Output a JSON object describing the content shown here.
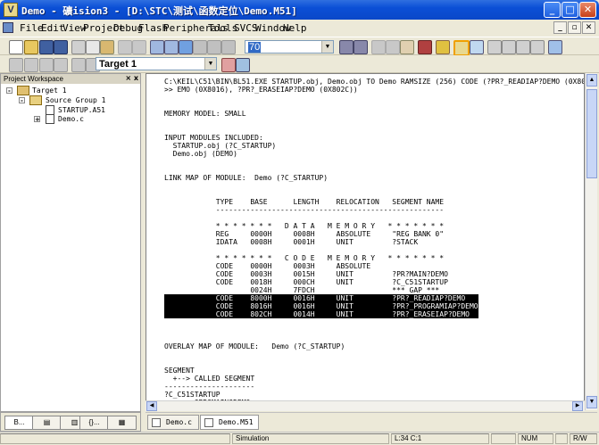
{
  "window": {
    "title": "Demo  - 礦ision3 - [D:\\STC\\测试\\函数定位\\Demo.M51]",
    "app_icon": "V"
  },
  "menu": [
    "File",
    "Edit",
    "View",
    "Project",
    "Debug",
    "Flash",
    "Peripherals",
    "Tools",
    "SVCS",
    "Window",
    "Help"
  ],
  "toolbar": {
    "find_value": "70",
    "target_value": "Target 1",
    "icons": [
      "new-file-icon",
      "open-folder-icon",
      "save-icon",
      "save-all-icon",
      "cut-icon",
      "copy-icon",
      "paste-icon",
      "undo-icon",
      "redo-icon",
      "indent-icon",
      "unindent-icon",
      "bookmark-icon",
      "bookmark-prev-icon",
      "bookmark-next-icon",
      "bookmark-clear-icon",
      "find-icon",
      "find-in-files-icon",
      "back-icon",
      "forward-icon",
      "browse-icon",
      "print-icon",
      "debug-icon"
    ]
  },
  "workspace": {
    "title": "Project Workspace",
    "tree": {
      "target": "Target 1",
      "group": "Source Group 1",
      "files": [
        "STARTUP.A51",
        "Demo.c"
      ]
    },
    "tabs": [
      "B...",
      "",
      "",
      "{}...",
      ""
    ]
  },
  "editor": {
    "lines": [
      "C:\\KEIL\\C51\\BIN\\BL51.EXE STARTUP.obj, Demo.obj TO Demo RAMSIZE (256) CODE (?PR?_READIAP?DEMO (0X80",
      ">> EMO (0X8016), ?PR?_ERASEIAP?DEMO (0X802C))",
      "",
      "",
      "MEMORY MODEL: SMALL",
      "",
      "",
      "INPUT MODULES INCLUDED:",
      "  STARTUP.obj (?C_STARTUP)",
      "  Demo.obj (DEMO)",
      "",
      "",
      "LINK MAP OF MODULE:  Demo (?C_STARTUP)",
      "",
      "",
      "            TYPE    BASE      LENGTH    RELOCATION   SEGMENT NAME",
      "            -----------------------------------------------------",
      "",
      "            * * * * * * *   D A T A   M E M O R Y   * * * * * * *",
      "            REG     0000H     0008H     ABSOLUTE     \"REG BANK 0\"",
      "            IDATA   0008H     0001H     UNIT         ?STACK",
      "",
      "            * * * * * * *   C O D E   M E M O R Y   * * * * * * *",
      "            CODE    0000H     0003H     ABSOLUTE",
      "            CODE    0003H     0015H     UNIT         ?PR?MAIN?DEMO",
      "            CODE    0018H     000CH     UNIT         ?C_C51STARTUP",
      "                    0024H     7FDCH                  *** GAP ***",
      "            CODE    8000H     0016H     UNIT         ?PR?_READIAP?DEMO",
      "            CODE    8016H     0016H     UNIT         ?PR?_PROGRAMIAP?DEMO",
      "            CODE    802CH     0014H     UNIT         ?PR?_ERASEIAP?DEMO",
      "",
      "",
      "",
      "OVERLAY MAP OF MODULE:   Demo (?C_STARTUP)",
      "",
      "",
      "SEGMENT",
      "  +--> CALLED SEGMENT",
      "---------------------",
      "?C_C51STARTUP",
      "  +--> ?PR?MAIN?DEMO"
    ],
    "highlighted": [
      27,
      28,
      29
    ]
  },
  "doc_tabs": [
    "Demo.c",
    "Demo.M51"
  ],
  "status": {
    "mode": "Simulation",
    "position": "L:34 C:1",
    "num": "NUM",
    "rw": "R/W"
  }
}
